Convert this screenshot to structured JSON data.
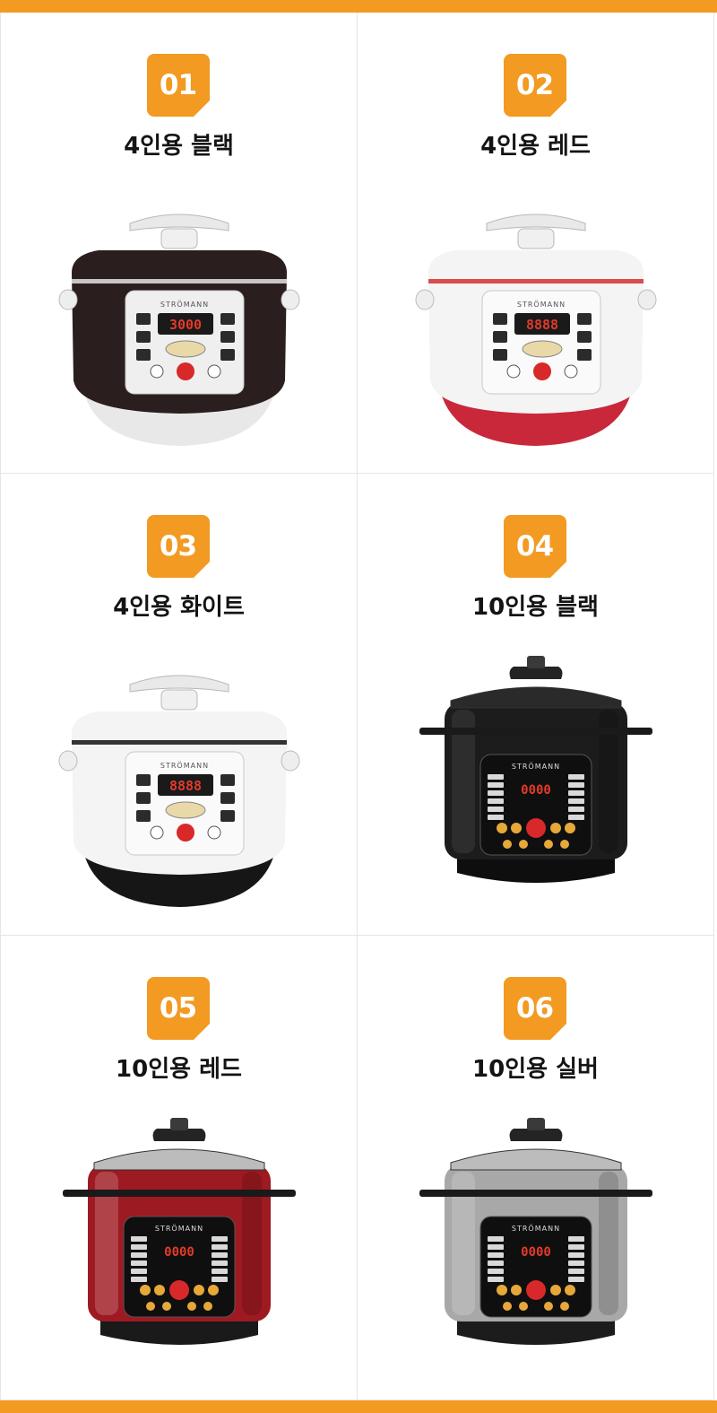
{
  "products": [
    {
      "number": "01",
      "name": "4인용 블랙",
      "brand": "STRÖMANN",
      "display": "3000",
      "body_color": "#2a1e1e",
      "accent": "#d8d8d8",
      "base_color": "#e8e8e8",
      "style": "compact"
    },
    {
      "number": "02",
      "name": "4인용 레드",
      "brand": "STRÖMANN",
      "display": "8888",
      "body_color": "#f4f4f4",
      "accent": "#d83a3a",
      "base_color": "#c8283a",
      "style": "compact"
    },
    {
      "number": "03",
      "name": "4인용 화이트",
      "brand": "STRÖMANN",
      "display": "8888",
      "body_color": "#f4f4f4",
      "accent": "#1e1e1e",
      "base_color": "#161616",
      "style": "compact"
    },
    {
      "number": "04",
      "name": "10인용 블랙",
      "brand": "STRÖMANN",
      "display": "0000",
      "body_color": "#1c1c1c",
      "accent": "#444444",
      "base_color": "#0e0e0e",
      "style": "large"
    },
    {
      "number": "05",
      "name": "10인용 레드",
      "brand": "STRÖMANN",
      "display": "0000",
      "body_color": "#9e1a22",
      "accent": "#2a2a2a",
      "base_color": "#1a1a1a",
      "style": "large"
    },
    {
      "number": "06",
      "name": "10인용 실버",
      "brand": "STRÖMANN",
      "display": "0000",
      "body_color": "#a8a8a8",
      "accent": "#2a2a2a",
      "base_color": "#1c1c1c",
      "style": "large"
    }
  ],
  "accent_color": "#f29a22"
}
